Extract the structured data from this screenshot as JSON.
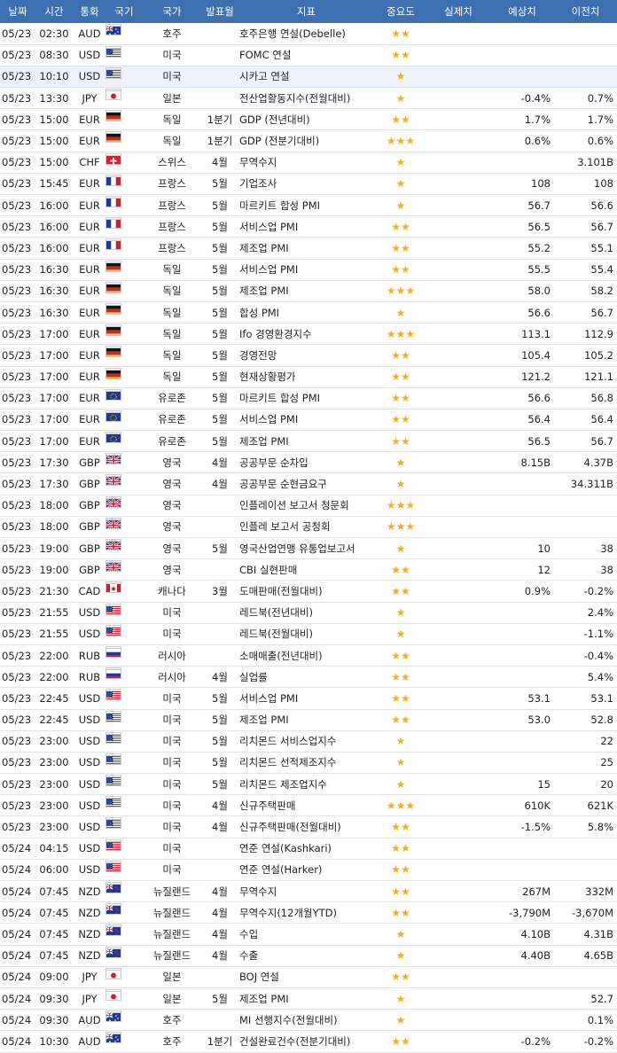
{
  "headers": [
    "날짜",
    "시간",
    "통화",
    "국기",
    "국가",
    "발표월",
    "지표",
    "중요도",
    "실제치",
    "예상치",
    "이전치"
  ],
  "rows": [
    {
      "date": "05/23",
      "time": "02:30",
      "cur": "AUD",
      "flag": "au",
      "country": "호주",
      "period": "",
      "indicator": "호주은행 연설(Debelle)",
      "stars": "★★",
      "actual": "",
      "forecast": "",
      "previous": ""
    },
    {
      "date": "05/23",
      "time": "08:30",
      "cur": "USD",
      "flag": "us",
      "country": "미국",
      "period": "",
      "indicator": "FOMC 연설",
      "stars": "★★",
      "actual": "",
      "forecast": "",
      "previous": ""
    },
    {
      "date": "05/23",
      "time": "10:10",
      "cur": "USD",
      "flag": "us",
      "country": "미국",
      "period": "",
      "indicator": "시카고 연설",
      "stars": "★",
      "actual": "",
      "forecast": "",
      "previous": ""
    },
    {
      "date": "05/23",
      "time": "13:30",
      "cur": "JPY",
      "flag": "jp",
      "country": "일본",
      "period": "",
      "indicator": "전산업활동지수(전월대비)",
      "stars": "★",
      "actual": "",
      "forecast": "-0.4%",
      "previous": "0.7%"
    },
    {
      "date": "05/23",
      "time": "15:00",
      "cur": "EUR",
      "flag": "de",
      "country": "독일",
      "period": "1분기",
      "indicator": "GDP (전년대비)",
      "stars": "★★",
      "actual": "",
      "forecast": "1.7%",
      "previous": "1.7%"
    },
    {
      "date": "05/23",
      "time": "15:00",
      "cur": "EUR",
      "flag": "de",
      "country": "독일",
      "period": "1분기",
      "indicator": "GDP (전분기대비)",
      "stars": "★★★",
      "actual": "",
      "forecast": "0.6%",
      "previous": "0.6%"
    },
    {
      "date": "05/23",
      "time": "15:00",
      "cur": "CHF",
      "flag": "ch",
      "country": "스위스",
      "period": "4월",
      "indicator": "무역수지",
      "stars": "★",
      "actual": "",
      "forecast": "",
      "previous": "3.101B"
    },
    {
      "date": "05/23",
      "time": "15:45",
      "cur": "EUR",
      "flag": "fr",
      "country": "프랑스",
      "period": "5월",
      "indicator": "기업조사",
      "stars": "★",
      "actual": "",
      "forecast": "108",
      "previous": "108"
    },
    {
      "date": "05/23",
      "time": "16:00",
      "cur": "EUR",
      "flag": "fr",
      "country": "프랑스",
      "period": "5월",
      "indicator": "마르키트 합성 PMI",
      "stars": "★",
      "actual": "",
      "forecast": "56.7",
      "previous": "56.6"
    },
    {
      "date": "05/23",
      "time": "16:00",
      "cur": "EUR",
      "flag": "fr",
      "country": "프랑스",
      "period": "5월",
      "indicator": "서비스업 PMI",
      "stars": "★★",
      "actual": "",
      "forecast": "56.5",
      "previous": "56.7"
    },
    {
      "date": "05/23",
      "time": "16:00",
      "cur": "EUR",
      "flag": "fr",
      "country": "프랑스",
      "period": "5월",
      "indicator": "제조업 PMI",
      "stars": "★★",
      "actual": "",
      "forecast": "55.2",
      "previous": "55.1"
    },
    {
      "date": "05/23",
      "time": "16:30",
      "cur": "EUR",
      "flag": "de",
      "country": "독일",
      "period": "5월",
      "indicator": "서비스업 PMI",
      "stars": "★★",
      "actual": "",
      "forecast": "55.5",
      "previous": "55.4"
    },
    {
      "date": "05/23",
      "time": "16:30",
      "cur": "EUR",
      "flag": "de",
      "country": "독일",
      "period": "5월",
      "indicator": "제조업 PMI",
      "stars": "★★★",
      "actual": "",
      "forecast": "58.0",
      "previous": "58.2"
    },
    {
      "date": "05/23",
      "time": "16:30",
      "cur": "EUR",
      "flag": "de",
      "country": "독일",
      "period": "5월",
      "indicator": "합성 PMI",
      "stars": "★",
      "actual": "",
      "forecast": "56.6",
      "previous": "56.7"
    },
    {
      "date": "05/23",
      "time": "17:00",
      "cur": "EUR",
      "flag": "de",
      "country": "독일",
      "period": "5월",
      "indicator": "Ifo 경영환경지수",
      "stars": "★★★",
      "actual": "",
      "forecast": "113.1",
      "previous": "112.9"
    },
    {
      "date": "05/23",
      "time": "17:00",
      "cur": "EUR",
      "flag": "de",
      "country": "독일",
      "period": "5월",
      "indicator": "경영전망",
      "stars": "★★",
      "actual": "",
      "forecast": "105.4",
      "previous": "105.2"
    },
    {
      "date": "05/23",
      "time": "17:00",
      "cur": "EUR",
      "flag": "de",
      "country": "독일",
      "period": "5월",
      "indicator": "현재상황평가",
      "stars": "★★",
      "actual": "",
      "forecast": "121.2",
      "previous": "121.1"
    },
    {
      "date": "05/23",
      "time": "17:00",
      "cur": "EUR",
      "flag": "eu",
      "country": "유로존",
      "period": "5월",
      "indicator": "마르키트 합성 PMI",
      "stars": "★★",
      "actual": "",
      "forecast": "56.6",
      "previous": "56.8"
    },
    {
      "date": "05/23",
      "time": "17:00",
      "cur": "EUR",
      "flag": "eu",
      "country": "유로존",
      "period": "5월",
      "indicator": "서비스업 PMI",
      "stars": "★★",
      "actual": "",
      "forecast": "56.4",
      "previous": "56.4"
    },
    {
      "date": "05/23",
      "time": "17:00",
      "cur": "EUR",
      "flag": "eu",
      "country": "유로존",
      "period": "5월",
      "indicator": "제조업 PMI",
      "stars": "★★",
      "actual": "",
      "forecast": "56.5",
      "previous": "56.7"
    },
    {
      "date": "05/23",
      "time": "17:30",
      "cur": "GBP",
      "flag": "gb",
      "country": "영국",
      "period": "4월",
      "indicator": "공공부문 순차입",
      "stars": "★",
      "actual": "",
      "forecast": "8.15B",
      "previous": "4.37B"
    },
    {
      "date": "05/23",
      "time": "17:30",
      "cur": "GBP",
      "flag": "gb",
      "country": "영국",
      "period": "4월",
      "indicator": "공공부문 순현금요구",
      "stars": "★",
      "actual": "",
      "forecast": "",
      "previous": "34.311B"
    },
    {
      "date": "05/23",
      "time": "18:00",
      "cur": "GBP",
      "flag": "gb",
      "country": "영국",
      "period": "",
      "indicator": "인플레이션 보고서 청문회",
      "stars": "★★★",
      "actual": "",
      "forecast": "",
      "previous": ""
    },
    {
      "date": "05/23",
      "time": "18:00",
      "cur": "GBP",
      "flag": "gb",
      "country": "영국",
      "period": "",
      "indicator": "인플레 보고서 공청회",
      "stars": "★★★",
      "actual": "",
      "forecast": "",
      "previous": ""
    },
    {
      "date": "05/23",
      "time": "19:00",
      "cur": "GBP",
      "flag": "gb",
      "country": "영국",
      "period": "5월",
      "indicator": "영국산업연맹 유통업보고서",
      "stars": "★",
      "actual": "",
      "forecast": "10",
      "previous": "38"
    },
    {
      "date": "05/23",
      "time": "19:00",
      "cur": "GBP",
      "flag": "gb",
      "country": "영국",
      "period": "",
      "indicator": "CBI 실현판매",
      "stars": "★★",
      "actual": "",
      "forecast": "12",
      "previous": "38"
    },
    {
      "date": "05/23",
      "time": "21:30",
      "cur": "CAD",
      "flag": "ca",
      "country": "캐나다",
      "period": "3월",
      "indicator": "도매판매(전월대비)",
      "stars": "★★",
      "actual": "",
      "forecast": "0.9%",
      "previous": "-0.2%"
    },
    {
      "date": "05/23",
      "time": "21:55",
      "cur": "USD",
      "flag": "us",
      "country": "미국",
      "period": "",
      "indicator": "레드북(전년대비)",
      "stars": "★",
      "actual": "",
      "forecast": "",
      "previous": "2.4%"
    },
    {
      "date": "05/23",
      "time": "21:55",
      "cur": "USD",
      "flag": "us",
      "country": "미국",
      "period": "",
      "indicator": "레드북(전월대비)",
      "stars": "★",
      "actual": "",
      "forecast": "",
      "previous": "-1.1%"
    },
    {
      "date": "05/23",
      "time": "22:00",
      "cur": "RUB",
      "flag": "ru",
      "country": "러시아",
      "period": "",
      "indicator": "소매매출(전년대비)",
      "stars": "★★",
      "actual": "",
      "forecast": "",
      "previous": "-0.4%"
    },
    {
      "date": "05/23",
      "time": "22:00",
      "cur": "RUB",
      "flag": "ru",
      "country": "러시아",
      "period": "4월",
      "indicator": "실업률",
      "stars": "★★",
      "actual": "",
      "forecast": "",
      "previous": "5.4%"
    },
    {
      "date": "05/23",
      "time": "22:45",
      "cur": "USD",
      "flag": "us",
      "country": "미국",
      "period": "5월",
      "indicator": "서비스업 PMI",
      "stars": "★★",
      "actual": "",
      "forecast": "53.1",
      "previous": "53.1"
    },
    {
      "date": "05/23",
      "time": "22:45",
      "cur": "USD",
      "flag": "us",
      "country": "미국",
      "period": "5월",
      "indicator": "제조업 PMI",
      "stars": "★★",
      "actual": "",
      "forecast": "53.0",
      "previous": "52.8"
    },
    {
      "date": "05/23",
      "time": "23:00",
      "cur": "USD",
      "flag": "us",
      "country": "미국",
      "period": "5월",
      "indicator": "리치몬드 서비스업지수",
      "stars": "★",
      "actual": "",
      "forecast": "",
      "previous": "22"
    },
    {
      "date": "05/23",
      "time": "23:00",
      "cur": "USD",
      "flag": "us",
      "country": "미국",
      "period": "5월",
      "indicator": "리치몬드 선적제조지수",
      "stars": "★",
      "actual": "",
      "forecast": "",
      "previous": "25"
    },
    {
      "date": "05/23",
      "time": "23:00",
      "cur": "USD",
      "flag": "us",
      "country": "미국",
      "period": "5월",
      "indicator": "리치몬드 제조업지수",
      "stars": "★",
      "actual": "",
      "forecast": "15",
      "previous": "20"
    },
    {
      "date": "05/23",
      "time": "23:00",
      "cur": "USD",
      "flag": "us",
      "country": "미국",
      "period": "4월",
      "indicator": "신규주택판매",
      "stars": "★★★",
      "actual": "",
      "forecast": "610K",
      "previous": "621K"
    },
    {
      "date": "05/23",
      "time": "23:00",
      "cur": "USD",
      "flag": "us",
      "country": "미국",
      "period": "4월",
      "indicator": "신규주택판매(전월대비)",
      "stars": "★★",
      "actual": "",
      "forecast": "-1.5%",
      "previous": "5.8%"
    },
    {
      "date": "05/24",
      "time": "04:15",
      "cur": "USD",
      "flag": "us",
      "country": "미국",
      "period": "",
      "indicator": "연준 연설(Kashkari)",
      "stars": "★★",
      "actual": "",
      "forecast": "",
      "previous": ""
    },
    {
      "date": "05/24",
      "time": "06:00",
      "cur": "USD",
      "flag": "us",
      "country": "미국",
      "period": "",
      "indicator": "연준 연설(Harker)",
      "stars": "★★",
      "actual": "",
      "forecast": "",
      "previous": ""
    },
    {
      "date": "05/24",
      "time": "07:45",
      "cur": "NZD",
      "flag": "nz",
      "country": "뉴질랜드",
      "period": "4월",
      "indicator": "무역수지",
      "stars": "★★",
      "actual": "",
      "forecast": "267M",
      "previous": "332M"
    },
    {
      "date": "05/24",
      "time": "07:45",
      "cur": "NZD",
      "flag": "nz",
      "country": "뉴질랜드",
      "period": "4월",
      "indicator": "무역수지(12개월YTD)",
      "stars": "★★",
      "actual": "",
      "forecast": "-3,790M",
      "previous": "-3,670M"
    },
    {
      "date": "05/24",
      "time": "07:45",
      "cur": "NZD",
      "flag": "nz",
      "country": "뉴질랜드",
      "period": "4월",
      "indicator": "수입",
      "stars": "★",
      "actual": "",
      "forecast": "4.10B",
      "previous": "4.31B"
    },
    {
      "date": "05/24",
      "time": "07:45",
      "cur": "NZD",
      "flag": "nz",
      "country": "뉴질랜드",
      "period": "4월",
      "indicator": "수출",
      "stars": "★",
      "actual": "",
      "forecast": "4.40B",
      "previous": "4.65B"
    },
    {
      "date": "05/24",
      "time": "09:00",
      "cur": "JPY",
      "flag": "jp",
      "country": "일본",
      "period": "",
      "indicator": "BOJ 연설",
      "stars": "★★",
      "actual": "",
      "forecast": "",
      "previous": ""
    },
    {
      "date": "05/24",
      "time": "09:30",
      "cur": "JPY",
      "flag": "jp",
      "country": "일본",
      "period": "5월",
      "indicator": "제조업 PMI",
      "stars": "★",
      "actual": "",
      "forecast": "",
      "previous": "52.7"
    },
    {
      "date": "05/24",
      "time": "09:30",
      "cur": "AUD",
      "flag": "au",
      "country": "호주",
      "period": "",
      "indicator": "MI 선행지수(전월대비)",
      "stars": "★",
      "actual": "",
      "forecast": "",
      "previous": "0.1%"
    },
    {
      "date": "05/24",
      "time": "10:30",
      "cur": "AUD",
      "flag": "au",
      "country": "호주",
      "period": "1분기",
      "indicator": "건설완료건수(전분기대비)",
      "stars": "★★",
      "actual": "",
      "forecast": "-0.2%",
      "previous": "-0.2%"
    }
  ],
  "highlighted_row": 2,
  "colors": {
    "header_bg": "#3e6fb0",
    "star": "#f2b01e",
    "row_line": "#dfe3ea",
    "highlight": "#eef3fb"
  }
}
